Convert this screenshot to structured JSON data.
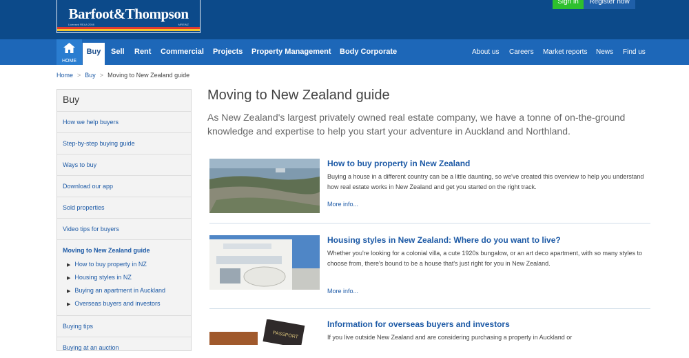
{
  "brand": {
    "logo_text": "Barfoot&Thompson",
    "tiny_left": "Licensed REAA 2008",
    "tiny_right": "MREINZ"
  },
  "auth": {
    "signin": "Sign in",
    "register": "Register now"
  },
  "nav": {
    "home_label": "HOME",
    "left": [
      "Buy",
      "Sell",
      "Rent",
      "Commercial",
      "Projects",
      "Property Management",
      "Body Corporate"
    ],
    "right": [
      "About us",
      "Careers",
      "Market reports",
      "News",
      "Find us"
    ]
  },
  "breadcrumb": {
    "home": "Home",
    "buy": "Buy",
    "current": "Moving to New Zealand guide",
    "sep": ">"
  },
  "sidebar": {
    "title": "Buy",
    "items": [
      "How we help buyers",
      "Step-by-step buying guide",
      "Ways to buy",
      "Download our app",
      "Sold properties",
      "Video tips for buyers"
    ],
    "active": "Moving to New Zealand guide",
    "sub_items": [
      "How to buy property in NZ",
      "Housing styles in NZ",
      "Buying an apartment in Auckland",
      "Overseas buyers and investors"
    ],
    "after": [
      "Buying tips",
      "Buying at an auction"
    ]
  },
  "main": {
    "title": "Moving to New Zealand guide",
    "intro": "As New Zealand's largest privately owned real estate company, we have a tonne of on-the-ground knowledge and expertise to help you start your adventure in Auckland and Northland.",
    "cards": [
      {
        "title": "How to buy property in New Zealand",
        "body": "Buying a house in a different country can be a little daunting, so we've created this overview to help you understand how real estate works in New Zealand and get you started on the right track.",
        "more": "More info..."
      },
      {
        "title": "Housing styles in New Zealand: Where do you want to live?",
        "body": "Whether you're looking for a colonial villa, a cute 1920s bungalow, or an art deco apartment, with so many styles to choose from, there's bound to be a house that's just right for you in New Zealand.",
        "more": "More info..."
      },
      {
        "title": "Information for overseas buyers and investors",
        "body": "If you live outside New Zealand and are considering purchasing a property in Auckland or",
        "more": ""
      }
    ]
  },
  "colors": {
    "navy": "#0c4a8a",
    "nav_blue": "#1d67b8",
    "link": "#1d5aa6",
    "green": "#2ec02e"
  },
  "icons": [
    "house-icon",
    "triangle-right-icon"
  ]
}
